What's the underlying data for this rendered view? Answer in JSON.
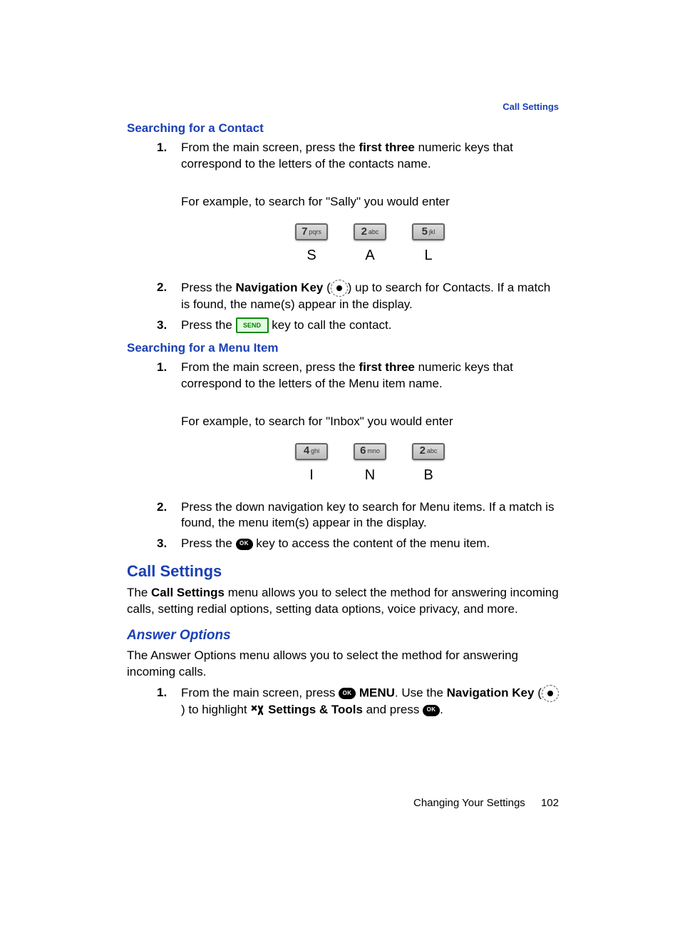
{
  "header_link": "Call Settings",
  "headings": {
    "search_contact": "Searching for a Contact",
    "search_menu": "Searching for a Menu Item",
    "call_settings": "Call Settings",
    "answer_options": "Answer Options"
  },
  "contact": {
    "step1_a": "From the main screen, press the ",
    "step1_b": "first three",
    "step1_c": " numeric keys that correspond to the letters of the contacts name.",
    "example": "For example, to search for \"Sally\" you would enter",
    "keys": [
      {
        "digit": "7",
        "letters": "pqrs",
        "out": "S"
      },
      {
        "digit": "2",
        "letters": "abc",
        "out": "A"
      },
      {
        "digit": "5",
        "letters": "jkl",
        "out": "L"
      }
    ],
    "step2_a": "Press the ",
    "step2_b": "Navigation Key",
    "step2_c": " up to search for Contacts. If a match is found, the name(s) appear in the display.",
    "step3_a": "Press the ",
    "step3_b": " key to call the contact."
  },
  "menu": {
    "step1_a": "From the main screen, press the ",
    "step1_b": "first three",
    "step1_c": " numeric keys that correspond to the letters of the Menu item name.",
    "example": "For example, to search for \"Inbox\" you would enter",
    "keys": [
      {
        "digit": "4",
        "letters": "ghi",
        "out": "I"
      },
      {
        "digit": "6",
        "letters": "mno",
        "out": "N"
      },
      {
        "digit": "2",
        "letters": "abc",
        "out": "B"
      }
    ],
    "step2": "Press the down navigation key to search for Menu items. If a match is found, the menu item(s) appear in the display.",
    "step3_a": "Press the ",
    "step3_b": " key to access the content of the menu item."
  },
  "call_settings": {
    "body_a": "The ",
    "body_b": "Call Settings",
    "body_c": " menu allows you to select the method for answering incoming calls, setting redial options, setting data options, voice privacy, and more."
  },
  "answer_options": {
    "body": "The Answer Options menu allows you to select the method for answering incoming calls.",
    "step1_a": "From the main screen, press ",
    "step1_b": "MENU",
    "step1_c": ". Use the ",
    "step1_d": "Navigation Key",
    "step1_e": " to highlight ",
    "step1_f": "Settings & Tools",
    "step1_g": " and press "
  },
  "labels": {
    "send": "SEND",
    "ok": "OK"
  },
  "nums": {
    "n1": "1.",
    "n2": "2.",
    "n3": "3."
  },
  "footer": {
    "section": "Changing Your Settings",
    "page": "102"
  }
}
